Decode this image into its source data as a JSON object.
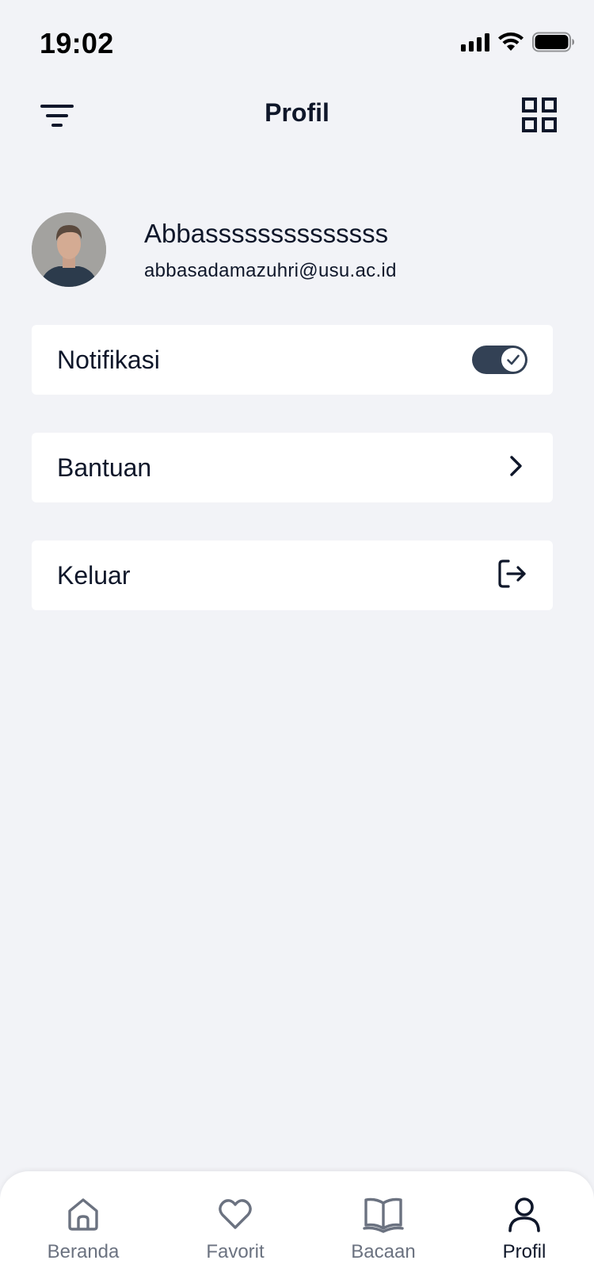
{
  "status_bar": {
    "time": "19:02"
  },
  "header": {
    "title": "Profil",
    "left_icon": "filter-icon",
    "right_icon": "grid-icon"
  },
  "profile": {
    "name": "Abbassssssssssssss",
    "email": "abbasadamazuhri@usu.ac.id"
  },
  "menu": {
    "notifications_label": "Notifikasi",
    "notifications_enabled": true,
    "help_label": "Bantuan",
    "logout_label": "Keluar"
  },
  "bottom_nav": {
    "items": [
      {
        "label": "Beranda",
        "icon": "home-icon",
        "active": false
      },
      {
        "label": "Favorit",
        "icon": "heart-icon",
        "active": false
      },
      {
        "label": "Bacaan",
        "icon": "book-icon",
        "active": false
      },
      {
        "label": "Profil",
        "icon": "user-icon",
        "active": true
      }
    ]
  },
  "colors": {
    "background": "#f2f3f7",
    "card": "#ffffff",
    "text": "#0f172a",
    "toggle_on": "#334155",
    "nav_inactive": "#6b7280"
  }
}
